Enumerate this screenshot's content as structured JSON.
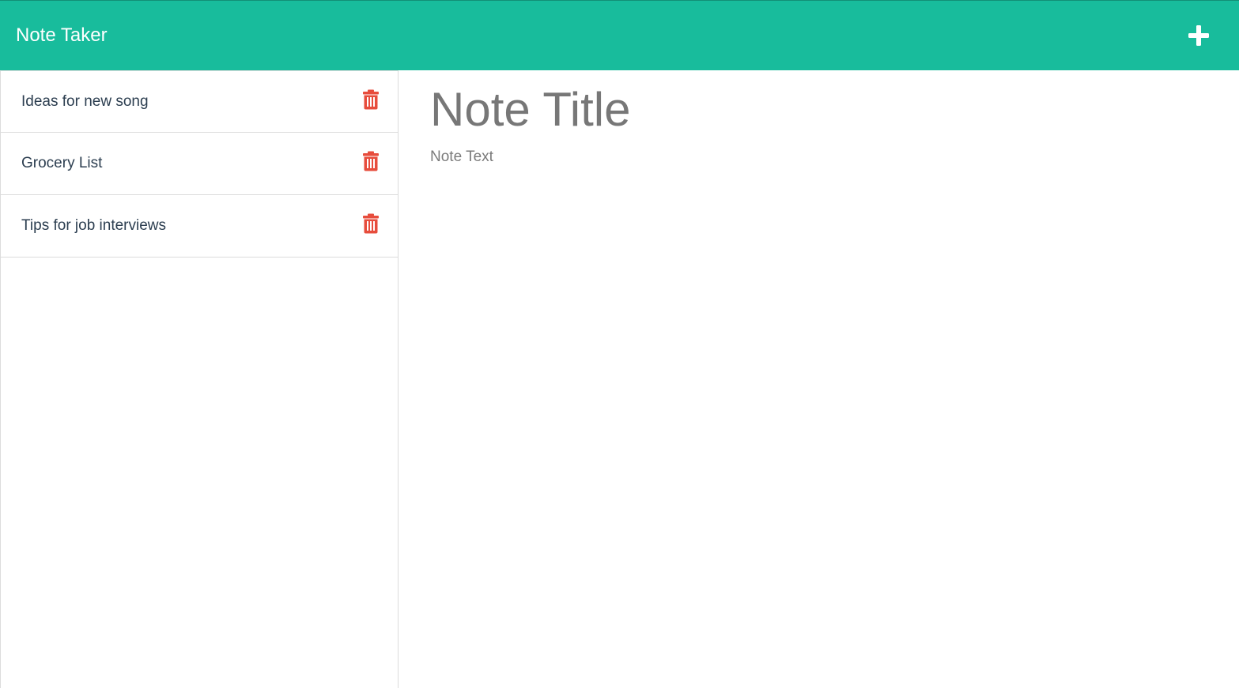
{
  "header": {
    "title": "Note Taker",
    "new_note_icon": "plus-icon",
    "background_color": "#18bc9c"
  },
  "sidebar": {
    "notes": [
      {
        "title": "Ideas for new song",
        "delete_icon": "trash-icon"
      },
      {
        "title": "Grocery List",
        "delete_icon": "trash-icon"
      },
      {
        "title": "Tips for job interviews",
        "delete_icon": "trash-icon"
      }
    ],
    "delete_icon_color": "#e74c3c"
  },
  "editor": {
    "title_placeholder": "Note Title",
    "title_value": "",
    "text_placeholder": "Note Text",
    "text_value": ""
  }
}
